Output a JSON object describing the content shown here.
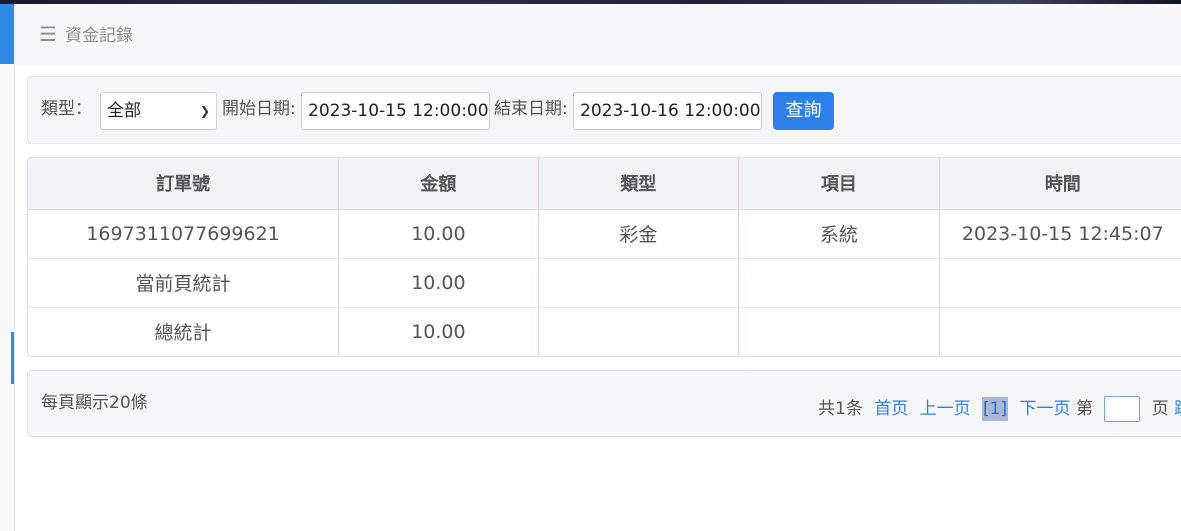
{
  "header": {
    "title": "資金記錄",
    "menu_icon": "hamburger-icon"
  },
  "filter": {
    "type_label": "類型：",
    "type_value": "全部",
    "start_label": "開始日期:",
    "start_value": "2023-10-15 12:00:00",
    "end_label": "結束日期:",
    "end_value": "2023-10-16 12:00:00",
    "query_button": "查詢"
  },
  "table": {
    "columns": [
      "訂單號",
      "金額",
      "類型",
      "項目",
      "時間"
    ],
    "rows": [
      [
        "1697311077699621",
        "10.00",
        "彩金",
        "系統",
        "2023-10-15 12:45:07"
      ],
      [
        "當前頁統計",
        "10.00",
        "",
        "",
        ""
      ],
      [
        "總統計",
        "10.00",
        "",
        "",
        ""
      ]
    ]
  },
  "pager": {
    "per_page": "每頁顯示20條",
    "total": "共1条",
    "first": "首页",
    "prev": "上一页",
    "current": "[1]",
    "next": "下一页",
    "goto_prefix": "第",
    "goto_suffix": "页",
    "jump": "跳"
  },
  "colors": {
    "accent": "#2f7fea",
    "panel_bg": "#f5f6f8",
    "header_bg": "#f1f3f6"
  }
}
